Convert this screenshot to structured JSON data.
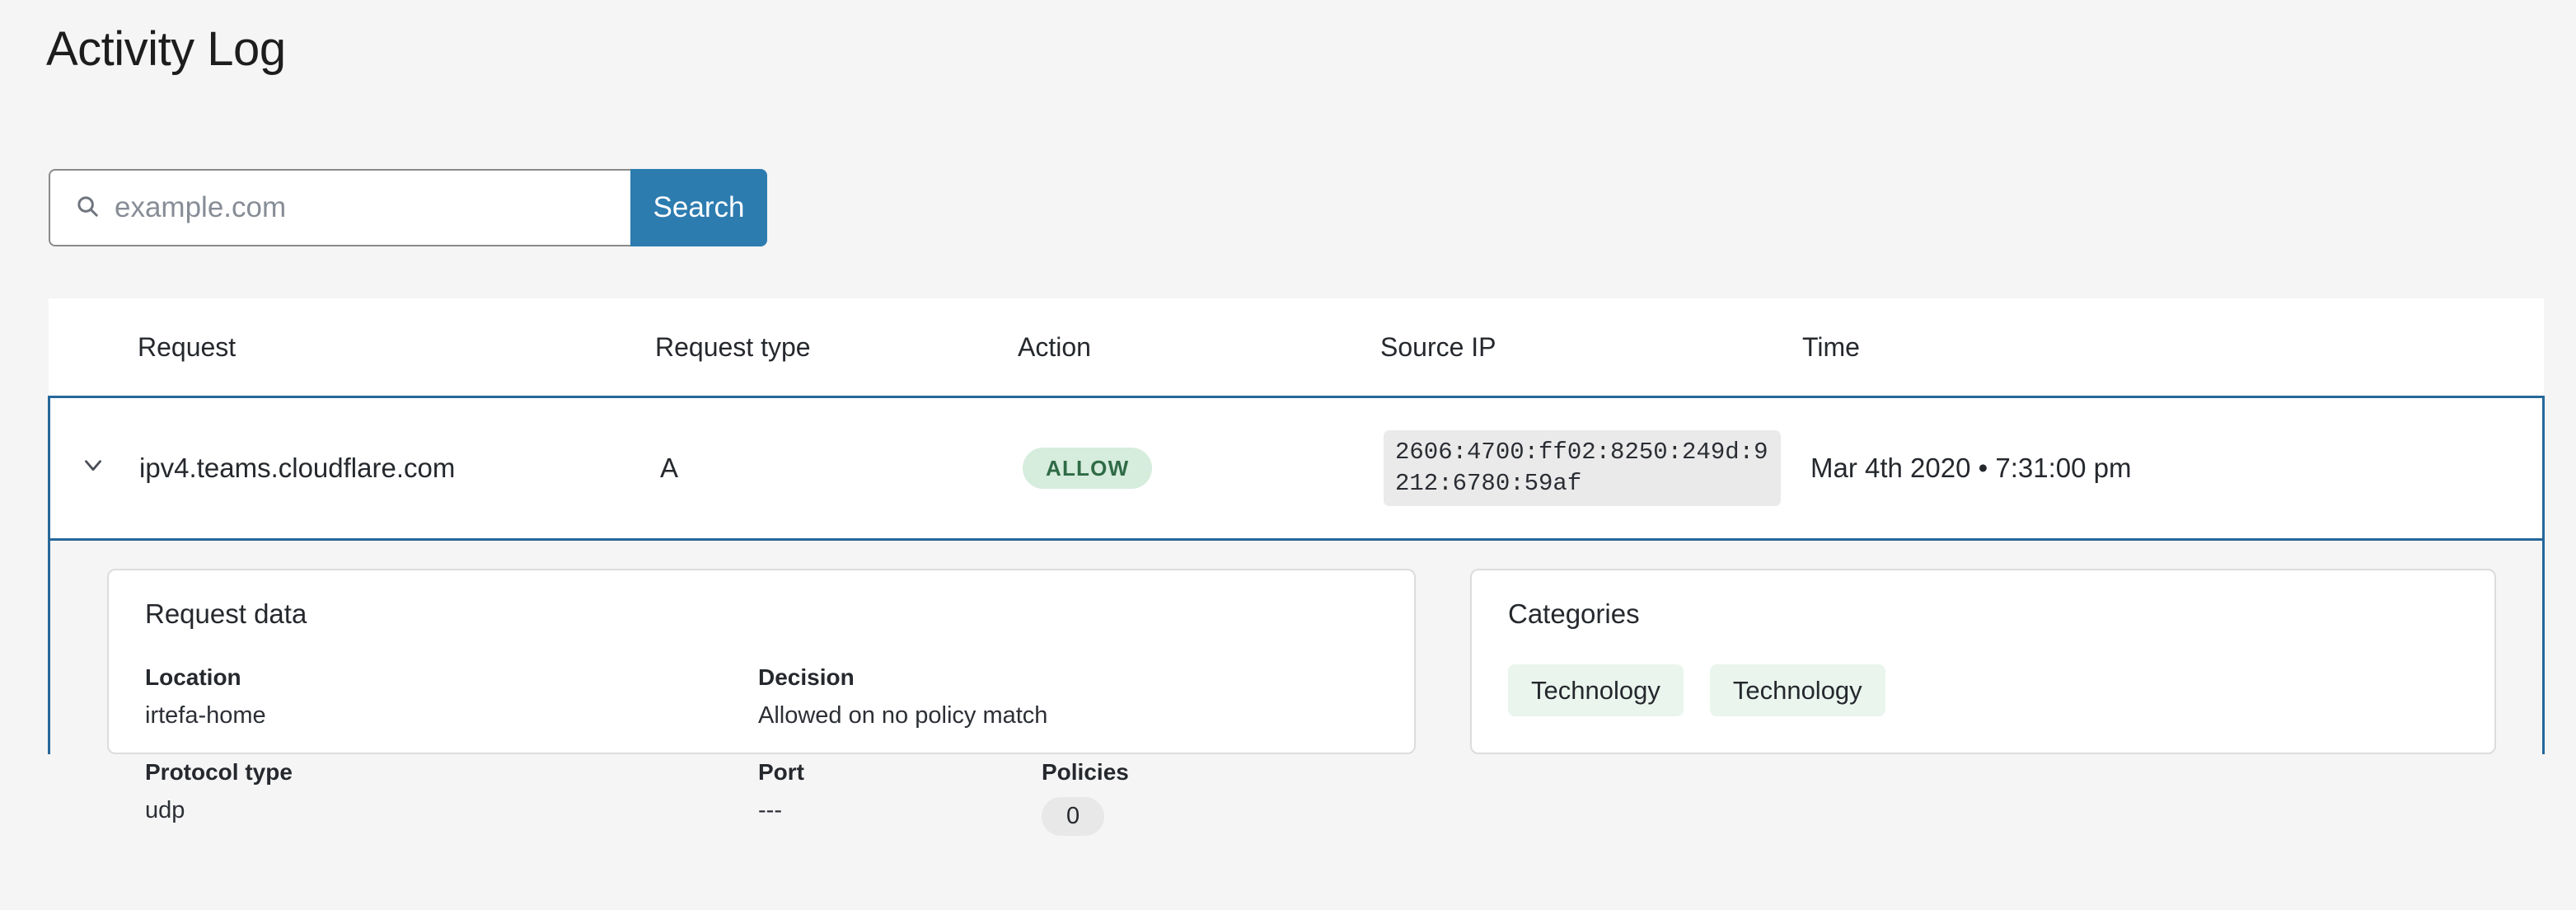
{
  "page": {
    "title": "Activity Log"
  },
  "search": {
    "placeholder": "example.com",
    "value": "",
    "button_label": "Search",
    "icon": "search-icon"
  },
  "table": {
    "columns": [
      {
        "key": "request",
        "label": "Request"
      },
      {
        "key": "request_type",
        "label": "Request type"
      },
      {
        "key": "action",
        "label": "Action"
      },
      {
        "key": "source_ip",
        "label": "Source IP"
      },
      {
        "key": "time",
        "label": "Time"
      }
    ],
    "rows": [
      {
        "expanded": true,
        "caret_icon": "chevron-down-icon",
        "request": "ipv4.teams.cloudflare.com",
        "request_type": "A",
        "action": "ALLOW",
        "source_ip": "2606:4700:ff02:8250:249d:9212:6780:59af",
        "time": "Mar 4th 2020 • 7:31:00 pm"
      }
    ]
  },
  "detail": {
    "request_data": {
      "title": "Request data",
      "location_label": "Location",
      "location_value": "irtefa-home",
      "decision_label": "Decision",
      "decision_value": "Allowed on no policy match",
      "protocol_label": "Protocol type",
      "protocol_value": "udp",
      "port_label": "Port",
      "port_value": "---",
      "policies_label": "Policies",
      "policies_value": "0"
    },
    "categories": {
      "title": "Categories",
      "items": [
        {
          "label": "Technology"
        },
        {
          "label": "Technology"
        }
      ]
    }
  },
  "colors": {
    "accent_blue": "#2d7cb0",
    "row_border_blue": "#26679a",
    "allow_badge_bg": "#d6ecdd",
    "allow_badge_text": "#2f6b46",
    "category_chip_bg": "#eaf5ee",
    "page_bg": "#f5f5f5"
  }
}
